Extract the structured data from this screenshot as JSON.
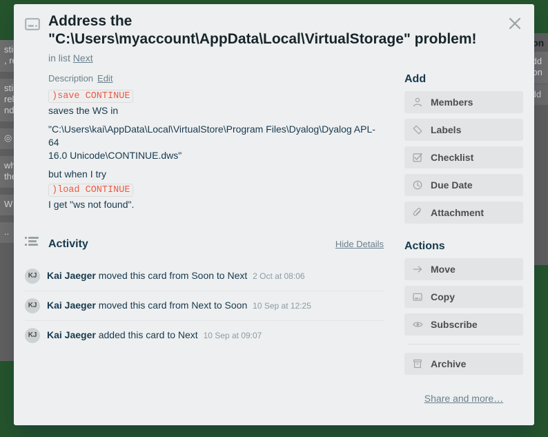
{
  "board_background": {
    "color": "#24532c",
    "left_list": {
      "cards": [
        "sting\n, re",
        "sting\nrela\nnd",
        "",
        "whi\nthe",
        "W",
        ".."
      ]
    },
    "right_list": {
      "title": "Don",
      "cards": [
        "Add\nCon"
      ],
      "add_label": "Add"
    }
  },
  "card": {
    "icon": "card-window-icon",
    "title": "Address the \"C:\\Users\\myaccount\\AppData\\Local\\VirtualStorage\" problem!",
    "in_list_prefix": "in list",
    "in_list_name": "Next",
    "close_icon": "close-icon"
  },
  "description": {
    "label": "Description",
    "edit_label": "Edit",
    "blocks": [
      {
        "type": "code",
        "text": ")save CONTINUE"
      },
      {
        "type": "text",
        "text": "saves the WS in\n\"C:\\Users\\kai\\AppData\\Local\\VirtualStore\\Program Files\\Dyalog\\Dyalog APL-64 16.0 Unicode\\CONTINUE.dws\""
      },
      {
        "type": "text",
        "text": "but when I try"
      },
      {
        "type": "code",
        "text": ")load CONTINUE"
      },
      {
        "type": "text",
        "text": "I get \"ws not found\"."
      }
    ],
    "line1": "saves the WS in",
    "line2": "\"C:\\Users\\kai\\AppData\\Local\\VirtualStore\\Program Files\\Dyalog\\Dyalog APL-64",
    "line3": "16.0 Unicode\\CONTINUE.dws\"",
    "line4": "but when I try",
    "line5": "I get \"ws not found\".",
    "code1": ")save CONTINUE",
    "code2": ")load CONTINUE"
  },
  "activity": {
    "title": "Activity",
    "icon": "activity-list-icon",
    "toggle_label": "Hide Details",
    "items": [
      {
        "avatar": "KJ",
        "who": "Kai Jaeger",
        "action": "moved this card from Soon to Next",
        "when": "2 Oct at 08:06"
      },
      {
        "avatar": "KJ",
        "who": "Kai Jaeger",
        "action": "moved this card from Next to Soon",
        "when": "10 Sep at 12:25"
      },
      {
        "avatar": "KJ",
        "who": "Kai Jaeger",
        "action": "added this card to Next",
        "when": "10 Sep at 09:07"
      }
    ]
  },
  "sidebar": {
    "add_title": "Add",
    "add_items": [
      {
        "label": "Members",
        "icon": "person-icon"
      },
      {
        "label": "Labels",
        "icon": "tag-icon"
      },
      {
        "label": "Checklist",
        "icon": "checkbox-icon"
      },
      {
        "label": "Due Date",
        "icon": "clock-icon"
      },
      {
        "label": "Attachment",
        "icon": "paperclip-icon"
      }
    ],
    "actions_title": "Actions",
    "action_items": [
      {
        "label": "Move",
        "icon": "arrow-right-icon"
      },
      {
        "label": "Copy",
        "icon": "card-window-icon"
      },
      {
        "label": "Subscribe",
        "icon": "eye-icon"
      }
    ],
    "archive": {
      "label": "Archive",
      "icon": "archive-box-icon"
    },
    "share_label": "Share and more…"
  },
  "colors": {
    "board": "#24532c",
    "modal_bg": "#edeff0",
    "button_bg": "#e2e4e6",
    "code_text": "#eb5a46",
    "title_text": "#18252a",
    "muted_text": "#6b808c"
  }
}
